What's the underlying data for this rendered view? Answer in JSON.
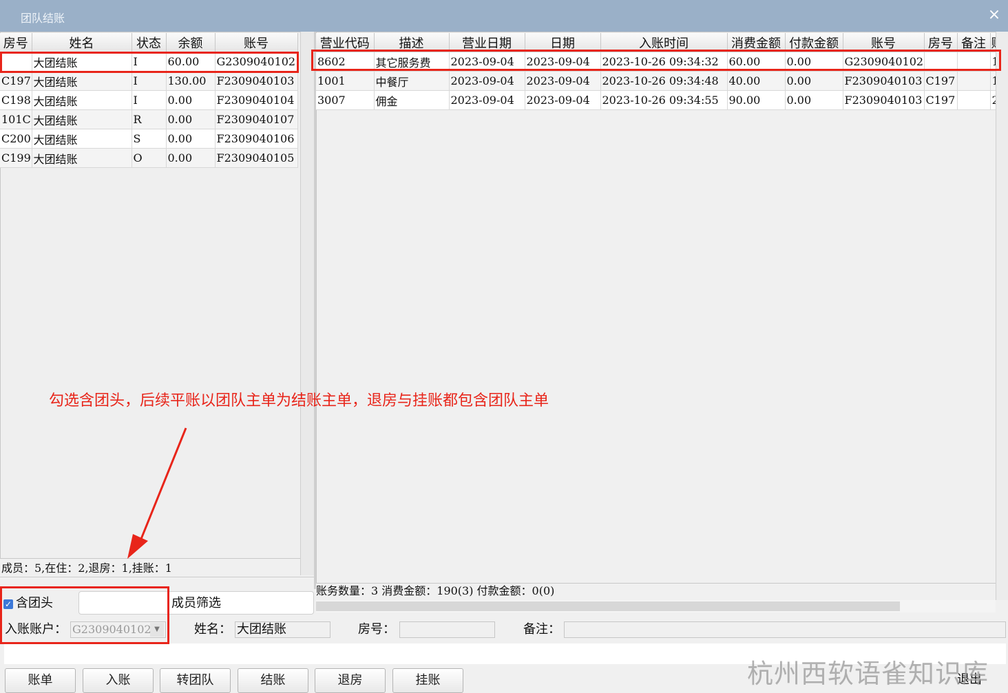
{
  "window": {
    "title": "团队结账",
    "close": "×"
  },
  "members": {
    "columns": [
      "房号",
      "姓名",
      "状态",
      "余额",
      "账号"
    ],
    "rows": [
      [
        "",
        "大团结账",
        "I",
        "60.00",
        "G2309040102"
      ],
      [
        "C197",
        "大团结账",
        "I",
        "130.00",
        "F2309040103"
      ],
      [
        "C198",
        "大团结账",
        "I",
        "0.00",
        "F2309040104"
      ],
      [
        "101C",
        "大团结账",
        "R",
        "0.00",
        "F2309040107"
      ],
      [
        "C200",
        "大团结账",
        "S",
        "0.00",
        "F2309040106"
      ],
      [
        "C199",
        "大团结账",
        "O",
        "0.00",
        "F2309040105"
      ]
    ],
    "status_text": "成员：5,在住：2,退房：1,挂账：1"
  },
  "transactions": {
    "columns": [
      "营业代码",
      "描述",
      "营业日期",
      "日期",
      "入账时间",
      "消费金额",
      "付款金额",
      "账号",
      "房号",
      "备注",
      "账"
    ],
    "rows": [
      [
        "8602",
        "其它服务费",
        "2023-09-04",
        "2023-09-04",
        "2023-10-26 09:34:32",
        "60.00",
        "0.00",
        "G2309040102",
        "",
        "",
        "1"
      ],
      [
        "1001",
        "中餐厅",
        "2023-09-04",
        "2023-09-04",
        "2023-10-26 09:34:48",
        "40.00",
        "0.00",
        "F2309040103",
        "C197",
        "",
        "1"
      ],
      [
        "3007",
        "佣金",
        "2023-09-04",
        "2023-09-04",
        "2023-10-26 09:34:55",
        "90.00",
        "0.00",
        "F2309040103",
        "C197",
        "",
        "2"
      ]
    ],
    "status_text": "账务数量：3  消费金额：190(3)  付款金额：0(0)"
  },
  "filter": {
    "include_leader_label": "含团头",
    "include_leader_checked": true,
    "member_filter_value": "",
    "member_filter_label": "成员筛选",
    "account_label": "入账账户：",
    "account_value": "G2309040102"
  },
  "info": {
    "name_label": "姓名：",
    "name_value": "大团结账",
    "room_label": "房号：",
    "room_value": "",
    "note_label": "备注：",
    "note_value": ""
  },
  "buttons": [
    "账单",
    "入账",
    "转团队",
    "结账",
    "退房",
    "挂账"
  ],
  "exit_label": "退出",
  "annotation": "勾选含团头，后续平账以团队主单为结账主单，退房与挂账都包含团队主单",
  "watermark": "杭州西软语雀知识库",
  "colors": {
    "title_bar": "#9ab0c8",
    "annotation_red": "#e8251a",
    "checkbox_blue": "#3c78d8"
  }
}
